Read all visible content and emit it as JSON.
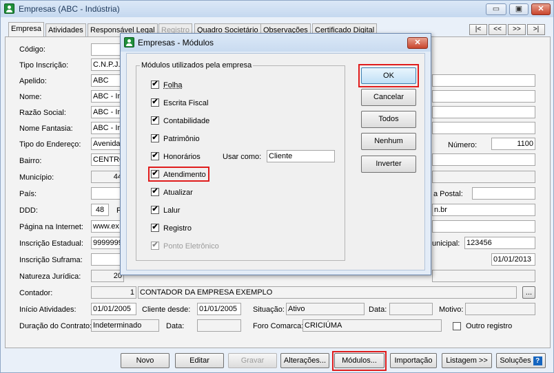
{
  "window": {
    "title": "Empresas (ABC - Indústria)",
    "buttons": [
      "▭",
      "▣",
      "✕"
    ]
  },
  "tabs": [
    {
      "label": "Empresa",
      "active": true
    },
    {
      "label": "Atividades"
    },
    {
      "label": "Responsável Legal"
    },
    {
      "label": "Registro",
      "disabled": true
    },
    {
      "label": "Quadro Societário"
    },
    {
      "label": "Observações"
    },
    {
      "label": "Certificado Digital"
    }
  ],
  "nav": [
    "|<",
    "<<",
    ">>",
    ">|"
  ],
  "form": {
    "codigo": "Código:",
    "tipo_inscricao": "Tipo Inscrição:",
    "tipo_inscricao_val": "C.N.P.J.",
    "apelido": "Apelido:",
    "apelido_val": "ABC",
    "nome": "Nome:",
    "nome_val": "ABC - In",
    "razao": "Razão Social:",
    "razao_val": "ABC - In",
    "fantasia": "Nome Fantasia:",
    "fantasia_val": "ABC - In",
    "tipo_end": "Tipo do Endereço:",
    "tipo_end_val": "Avenida",
    "numero": "Número:",
    "numero_val": "1100",
    "bairro": "Bairro:",
    "bairro_val": "CENTRO",
    "municipio": "Município:",
    "municipio_val": "44",
    "pais": "País:",
    "caixa_postal": "a Postal:",
    "ddd": "DDD:",
    "ddd_val": "48",
    "ddd_r": "F",
    "email_tail": "n.br",
    "pagina": "Página na Internet:",
    "pagina_val": "www.ex",
    "insc_est": "Inscrição Estadual:",
    "insc_est_val": "9999999",
    "insc_mun": "unicipal:",
    "insc_mun_val": "123456",
    "suframa": "Inscrição Suframa:",
    "suframa_date": "01/01/2013",
    "natureza": "Natureza Jurídica:",
    "natureza_val": "20",
    "contador": "Contador:",
    "contador_cod": "1",
    "contador_nome": "CONTADOR DA EMPRESA EXEMPLO",
    "contador_btn": "...",
    "inicio": "Início Atividades:",
    "inicio_val": "01/01/2005",
    "cliente_desde": "Cliente desde:",
    "cliente_desde_val": "01/01/2005",
    "situacao": "Situação:",
    "situacao_val": "Ativo",
    "data": "Data:",
    "motivo": "Motivo:",
    "duracao": "Duração do Contrato:",
    "duracao_val": "Indeterminado",
    "data2": "Data:",
    "foro": "Foro Comarca:",
    "foro_val": "CRICIÚMA",
    "outro_registro": "Outro registro"
  },
  "bottom_buttons": {
    "novo": "Novo",
    "editar": "Editar",
    "gravar": "Gravar",
    "alteracoes": "Alterações...",
    "modulos": "Módulos...",
    "importacao": "Importação",
    "listagem": "Listagem >>",
    "solucoes": "Soluções",
    "help": "?"
  },
  "dialog": {
    "title": "Empresas - Módulos",
    "group_label": "Módulos utilizados pela empresa",
    "modules": [
      {
        "label": "Folha",
        "checked": true
      },
      {
        "label": "Escrita Fiscal",
        "checked": true
      },
      {
        "label": "Contabilidade",
        "checked": true
      },
      {
        "label": "Patrimônio",
        "checked": true
      },
      {
        "label": "Honorários",
        "checked": true
      },
      {
        "label": "Atendimento",
        "checked": true
      },
      {
        "label": "Atualizar",
        "checked": true
      },
      {
        "label": "Lalur",
        "checked": true
      },
      {
        "label": "Registro",
        "checked": true
      },
      {
        "label": "Ponto Eletrônico",
        "checked": true,
        "disabled": true
      }
    ],
    "usar_como_label": "Usar como:",
    "usar_como_val": "Cliente",
    "buttons": {
      "ok": "OK",
      "cancelar": "Cancelar",
      "todos": "Todos",
      "nenhum": "Nenhum",
      "inverter": "Inverter"
    },
    "close": "✕",
    "check_mark": "✔"
  }
}
